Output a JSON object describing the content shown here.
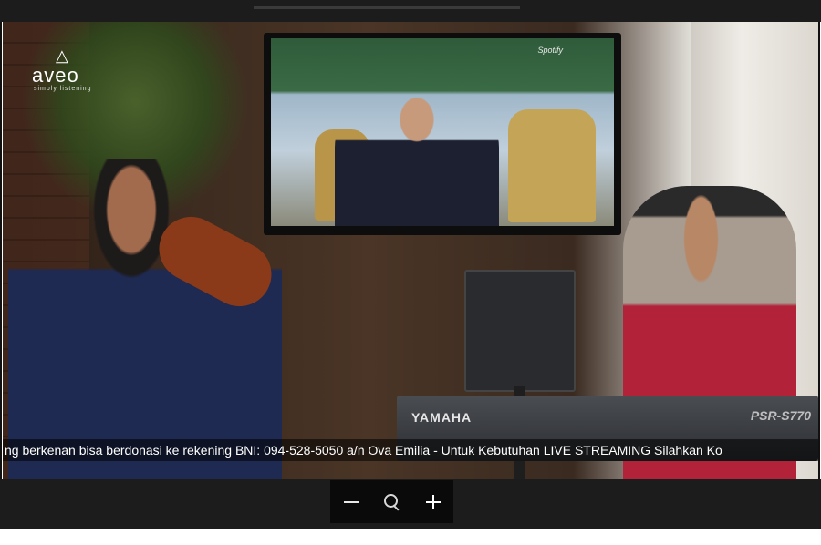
{
  "window": {
    "frame_color": "#1c1c1c"
  },
  "video": {
    "watermark": {
      "logo_text": "aveo",
      "tagline": "simply listening"
    },
    "tv_screen": {
      "channel_logo": "Spotify"
    },
    "keyboard": {
      "brand": "YAMAHA",
      "model": "PSR-S770"
    },
    "ticker": {
      "text": "ng berkenan bisa berdonasi ke rekening BNI: 094-528-5050 a/n Ova Emilia  -  Untuk Kebutuhan LIVE STREAMING Silahkan Ko"
    }
  },
  "zoom_controls": {
    "zoom_out_icon": "minus-icon",
    "zoom_reset_icon": "magnifier-icon",
    "zoom_in_icon": "plus-icon"
  },
  "colors": {
    "ticker_bg": "#000000",
    "ticker_text": "#ffffff",
    "control_bg": "#0a0a0a"
  }
}
